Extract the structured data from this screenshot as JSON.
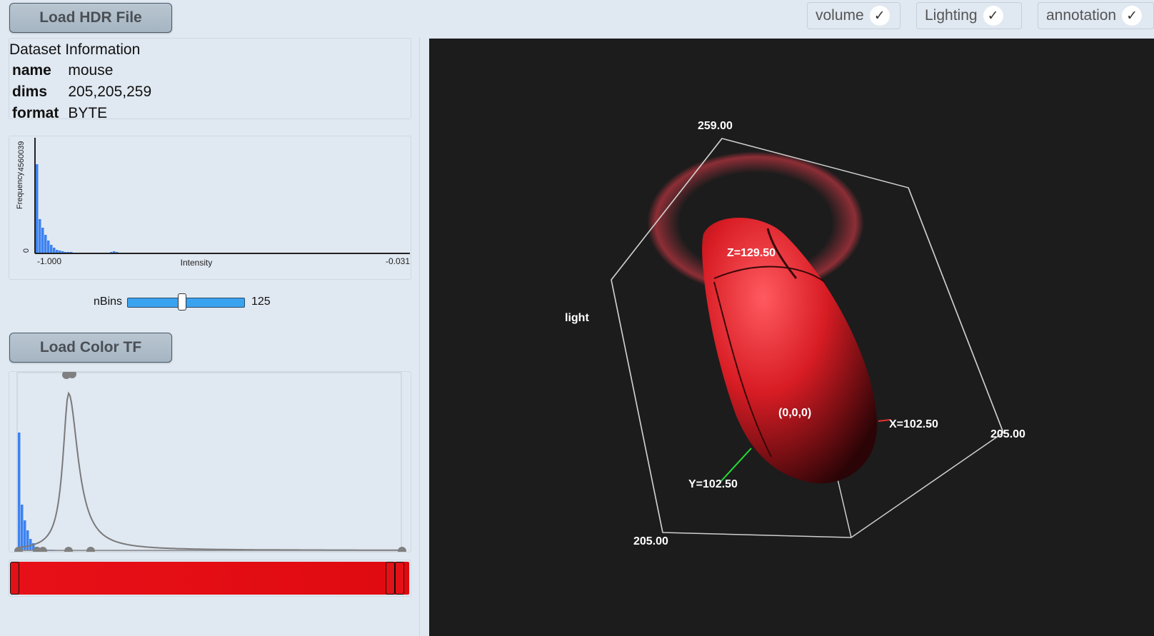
{
  "toolbar": {
    "load_hdr_label": "Load HDR File",
    "load_color_tf_label": "Load Color TF",
    "toggles": [
      {
        "label": "volume",
        "check": "✓"
      },
      {
        "label": "Lighting",
        "check": "✓"
      },
      {
        "label": "annotation",
        "check": "✓"
      }
    ]
  },
  "dataset": {
    "title": "Dataset Information",
    "rows": [
      {
        "key": "name",
        "value": "mouse"
      },
      {
        "key": "dims",
        "value": "205,205,259"
      },
      {
        "key": "format",
        "value": "BYTE"
      }
    ]
  },
  "histogram": {
    "ylabel": "Frequency",
    "ytick_top": "4560039",
    "ytick_zero": "0",
    "xlabel": "Intensity",
    "xmin_label": "-1.000",
    "xmax_label": "-0.031",
    "bar_color": "#3d82f0"
  },
  "nbins": {
    "label": "nBins",
    "value": "125",
    "fraction": 0.47
  },
  "transfer_function": {
    "color": "#e30e14",
    "axis_color": "#808080"
  },
  "view": {
    "background": "#1c1c1c",
    "labels": {
      "top": "259.00",
      "light": "light",
      "z_axis": "Z=129.50",
      "origin": "(0,0,0)",
      "x_axis": "X=102.50",
      "right": "205.00",
      "y_axis": "Y=102.50",
      "bottom": "205.00"
    }
  }
}
